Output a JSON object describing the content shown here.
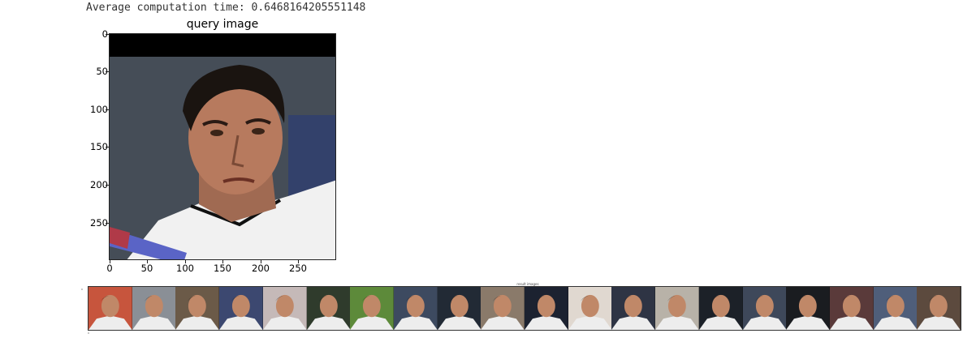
{
  "console": {
    "computation_line": "Average computation time: 0.6468164205551148"
  },
  "query_plot": {
    "title": "query image",
    "yticks": [
      "0",
      "50",
      "100",
      "150",
      "200",
      "250"
    ],
    "xticks": [
      "0",
      "50",
      "100",
      "150",
      "200",
      "250"
    ],
    "image_desc": "face-photo-tennis-player"
  },
  "result_plot": {
    "title": "result images",
    "thumbnail_count": 20,
    "thumb_colors": [
      "#c7553d",
      "#8a8f96",
      "#6b5a48",
      "#3c4870",
      "#c5b9b8",
      "#2f3b2c",
      "#5d8a3a",
      "#3d4a60",
      "#222a35",
      "#8a7a6a",
      "#1c2230",
      "#e0d8d0",
      "#2e3444",
      "#b8b2a8",
      "#1c2128",
      "#3e485a",
      "#1a1c20",
      "#5a3a3a",
      "#4f5e7a",
      "#5c4a3e"
    ]
  }
}
